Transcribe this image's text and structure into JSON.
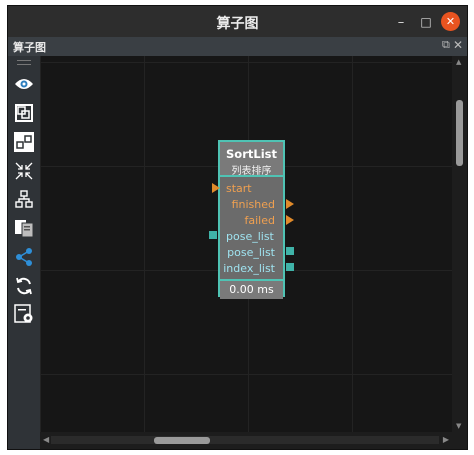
{
  "window": {
    "title": "算子图"
  },
  "panel": {
    "title": "算子图"
  },
  "toolbar": {
    "items": [
      {
        "name": "eye-icon"
      },
      {
        "name": "fit-view-icon"
      },
      {
        "name": "connect-nodes-icon"
      },
      {
        "name": "collapse-icon"
      },
      {
        "name": "hierarchy-icon"
      },
      {
        "name": "copy-icon"
      },
      {
        "name": "share-nodes-icon"
      },
      {
        "name": "refresh-icon"
      },
      {
        "name": "settings-icon"
      }
    ]
  },
  "node": {
    "name": "SortList",
    "subtitle": "列表排序",
    "exec_in": [
      "start"
    ],
    "exec_out": [
      "finished",
      "failed"
    ],
    "data_in": [
      "pose_list"
    ],
    "data_out": [
      "pose_list",
      "index_list"
    ],
    "time": "0.00 ms"
  },
  "colors": {
    "node_border": "#4fc3b4",
    "exec_port": "#e08a2a",
    "data_port": "#3fb3a8",
    "close_button": "#e95420"
  }
}
